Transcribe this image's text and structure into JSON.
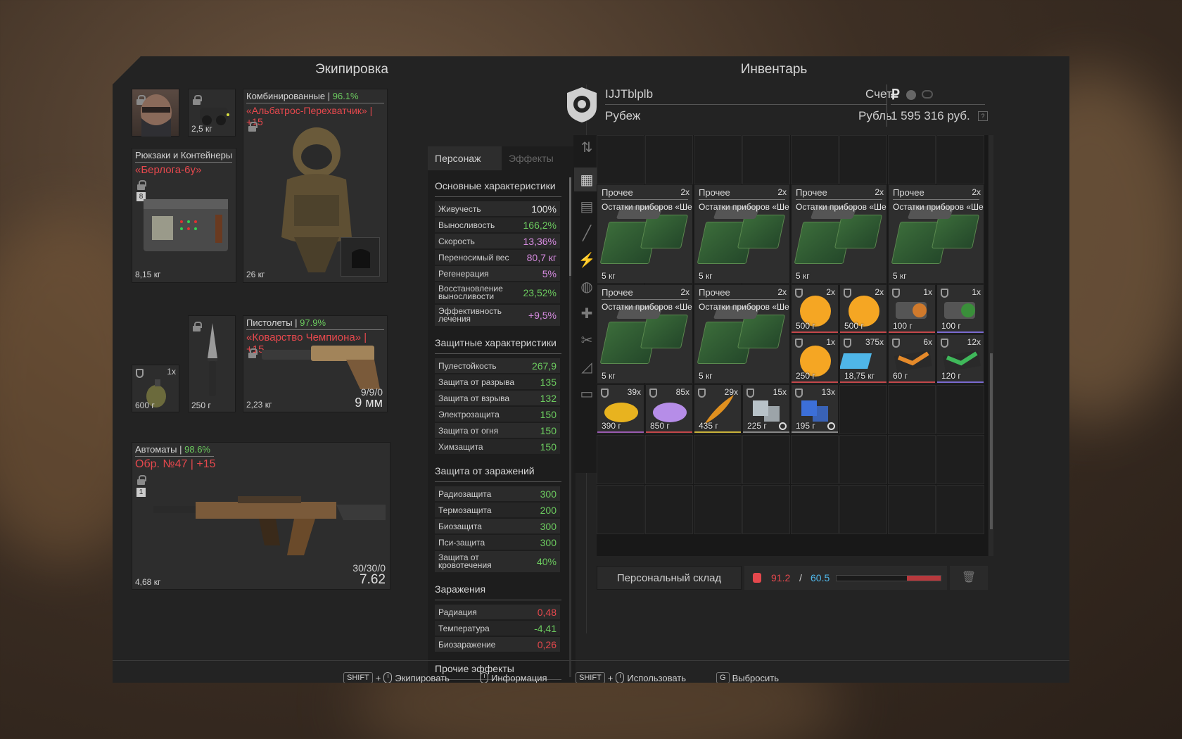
{
  "equipment": {
    "title": "Экипировка",
    "face_slot": {
      "icon": "face-mask-portrait"
    },
    "device_slot": {
      "weight": "2,5 кг",
      "icon": "night-vision-device"
    },
    "backpack": {
      "category": "Рюкзаки и Контейнеры",
      "name": "«Берлога-6у»",
      "weight": "8,15 кг",
      "badge": "8"
    },
    "armor": {
      "category": "Комбинированные",
      "durability": "96.1%",
      "name": "«Альбатрос-Перехватчик» | +15",
      "weight": "26 кг"
    },
    "grenade": {
      "count": "1x",
      "weight": "600 г"
    },
    "knife": {
      "weight": "250 г"
    },
    "pistol": {
      "category": "Пистолеты",
      "durability": "97.9%",
      "name": "«Коварство Чемпиона» | +15",
      "weight": "2,23 кг",
      "ammo": "9/9/0",
      "caliber": "9 мм"
    },
    "rifle": {
      "category": "Автоматы",
      "durability": "98.6%",
      "name": "Обр. №47 | +15",
      "weight": "4,68 кг",
      "ammo": "30/30/0",
      "caliber": "7.62",
      "badge": "1"
    }
  },
  "stats": {
    "tab_character": "Персонаж",
    "tab_effects": "Эффекты",
    "sections": [
      {
        "title": "Основные характеристики",
        "rows": [
          {
            "label": "Живучесть",
            "value": "100%",
            "color": "#e0e0e0"
          },
          {
            "label": "Выносливость",
            "value": "166,2%",
            "color": "#6ccb5f"
          },
          {
            "label": "Скорость",
            "value": "13,36%",
            "color": "#d68be0"
          },
          {
            "label": "Переносимый вес",
            "value": "80,7 кг",
            "color": "#d68be0"
          },
          {
            "label": "Регенерация",
            "value": "5%",
            "color": "#d68be0"
          },
          {
            "label": "Восстановление выносливости",
            "value": "23,52%",
            "color": "#6ccb5f",
            "two": true
          },
          {
            "label": "Эффективность лечения",
            "value": "+9,5%",
            "color": "#d68be0",
            "two": true
          }
        ]
      },
      {
        "title": "Защитные характеристики",
        "rows": [
          {
            "label": "Пулестойкость",
            "value": "267,9",
            "color": "#6ccb5f"
          },
          {
            "label": "Защита от разрыва",
            "value": "135",
            "color": "#6ccb5f"
          },
          {
            "label": "Защита от взрыва",
            "value": "132",
            "color": "#6ccb5f"
          },
          {
            "label": "Электрозащита",
            "value": "150",
            "color": "#6ccb5f"
          },
          {
            "label": "Защита от огня",
            "value": "150",
            "color": "#6ccb5f"
          },
          {
            "label": "Химзащита",
            "value": "150",
            "color": "#6ccb5f"
          }
        ]
      },
      {
        "title": "Защита от заражений",
        "rows": [
          {
            "label": "Радиозащита",
            "value": "300",
            "color": "#6ccb5f"
          },
          {
            "label": "Термозащита",
            "value": "200",
            "color": "#6ccb5f"
          },
          {
            "label": "Биозащита",
            "value": "300",
            "color": "#6ccb5f"
          },
          {
            "label": "Пси-защита",
            "value": "300",
            "color": "#6ccb5f"
          },
          {
            "label": "Защита от кровотечения",
            "value": "40%",
            "color": "#6ccb5f",
            "two": true
          }
        ]
      },
      {
        "title": "Заражения",
        "rows": [
          {
            "label": "Радиация",
            "value": "0,48",
            "color": "#e5484d"
          },
          {
            "label": "Температура",
            "value": "-4,41",
            "color": "#6ccb5f"
          },
          {
            "label": "Биозаражение",
            "value": "0,26",
            "color": "#e5484d"
          }
        ]
      },
      {
        "title": "Прочие эффекты",
        "rows": []
      }
    ]
  },
  "inventory": {
    "title": "Инвентарь",
    "player_name": "IJJTblplb",
    "faction": "Рубеж",
    "account_label": "Счет",
    "currency_label": "Рубль",
    "balance": "1 595 316 руб.",
    "help": "?",
    "storage_label": "Персональный склад",
    "weight_current": "91.2",
    "weight_sep": "/",
    "weight_max": "60.5",
    "weight_fill": 1.0,
    "items": [
      {
        "name": "Прочее",
        "count": "2x",
        "sub": "Остатки приборов «Ше...",
        "weight": "5 кг",
        "kind": "pcb"
      },
      {
        "name": "Прочее",
        "count": "2x",
        "sub": "Остатки приборов «Ше...",
        "weight": "5 кг",
        "kind": "pcb"
      },
      {
        "name": "Прочее",
        "count": "2x",
        "sub": "Остатки приборов «Ше...",
        "weight": "5 кг",
        "kind": "pcb"
      },
      {
        "name": "Прочее",
        "count": "2x",
        "sub": "Остатки приборов «Ше...",
        "weight": "5 кг",
        "kind": "pcb"
      },
      {
        "name": "Прочее",
        "count": "2x",
        "sub": "Остатки приборов «Ше...",
        "weight": "5 кг",
        "kind": "pcb"
      },
      {
        "name": "Прочее",
        "count": "2x",
        "sub": "Остатки приборов «Ше...",
        "weight": "5 кг",
        "kind": "pcb"
      },
      {
        "count": "2x",
        "weight": "500 г",
        "kind": "orange-ball",
        "color": "#f5a623"
      },
      {
        "count": "2x",
        "weight": "500 г",
        "kind": "orange-ball",
        "color": "#f5a623"
      },
      {
        "count": "1x",
        "weight": "100 г",
        "kind": "device-orange",
        "color": "#d07a2c"
      },
      {
        "count": "1x",
        "weight": "100 г",
        "kind": "device-green",
        "color": "#3a8f3a"
      },
      {
        "count": "1x",
        "weight": "250 г",
        "kind": "orange-ball",
        "color": "#f5a623"
      },
      {
        "count": "375x",
        "weight": "18,75 кг",
        "kind": "blue-crystals",
        "color": "#4fb6e8"
      },
      {
        "count": "6x",
        "weight": "60 г",
        "kind": "box-orange",
        "color": "#e58a2a"
      },
      {
        "count": "12x",
        "weight": "120 г",
        "kind": "box-green",
        "color": "#3fb85a"
      },
      {
        "count": "39x",
        "weight": "390 г",
        "kind": "yellow-powder",
        "color": "#e8b31f"
      },
      {
        "count": "85x",
        "weight": "850 г",
        "kind": "purple-powder",
        "color": "#b68de8"
      },
      {
        "count": "29x",
        "weight": "435 г",
        "kind": "feather",
        "color": "#e0901f"
      },
      {
        "count": "15x",
        "weight": "225 г",
        "kind": "silver-cubes",
        "color": "#b8c2c8"
      },
      {
        "count": "13x",
        "weight": "195 г",
        "kind": "blue-cubes",
        "color": "#3c6fd8"
      }
    ]
  },
  "hints": [
    {
      "key": "SHIFT",
      "plus": "+",
      "label": "Экипировать"
    },
    {
      "label": "Информация"
    },
    {
      "key": "SHIFT",
      "plus": "+",
      "label": "Использовать"
    },
    {
      "key": "G",
      "label": "Выбросить"
    }
  ]
}
